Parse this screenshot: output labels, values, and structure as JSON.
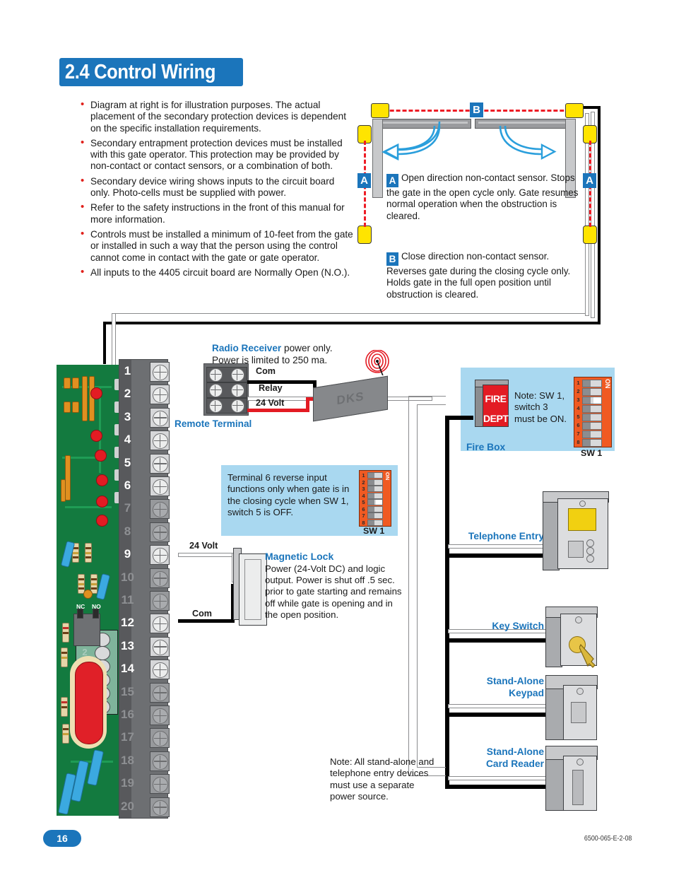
{
  "header": {
    "section_number": "2.4",
    "title": "2.4 Control Wiring"
  },
  "bullets": [
    "Diagram at right is for illustration purposes. The actual placement of the secondary protection devices is dependent on the specific installation requirements.",
    "Secondary entrapment protection devices must be installed with this gate operator. This protection may be provided by non-contact or contact sensors, or a combination of both.",
    "Secondary device wiring shows inputs to the circuit board only. Photo-cells must be supplied with power.",
    "Refer to the safety instructions in the front of this manual for more information.",
    "Controls must be installed a minimum of 10-feet from the gate or installed in such a way that the person using the control cannot come in contact with the gate or gate operator.",
    "All inputs to the 4405 circuit board are Normally Open (N.O.)."
  ],
  "gate_diagram": {
    "badge_a": "A",
    "badge_b": "B",
    "sensor_a_text": "Open direction non-contact sensor. Stops the gate in the open cycle only. Gate resumes normal operation when the obstruction is cleared.",
    "sensor_b_text": "Close direction non-contact sensor. Reverses gate during the closing cycle only. Holds gate in the full open position until obstruction is cleared."
  },
  "radio_receiver": {
    "title_bold": "Radio Receiver",
    "title_rest": " power only.",
    "line2": "Power is limited to 250 ma.",
    "terminal_label": "Remote Terminal",
    "wire_com": "Com",
    "wire_relay": "Relay",
    "wire_24volt": "24 Volt",
    "device_brand": "DKS"
  },
  "fire_box": {
    "label": "Fire Box",
    "face_line1": "FIRE",
    "face_line2": "DEPT",
    "note": "Note: SW 1, switch 3 must be ON.",
    "dip_label": "SW 1",
    "dip_on_label": "ON",
    "dip_positions": [
      "1",
      "2",
      "3",
      "4",
      "5",
      "6",
      "7",
      "8"
    ],
    "dip_active": 3
  },
  "terminal6_note": {
    "text": "Terminal 6 reverse input functions only when gate is in the closing cycle when SW 1, switch 5 is OFF.",
    "dip_label": "SW 1",
    "dip_on_label": "ON",
    "dip_positions": [
      "1",
      "2",
      "3",
      "4",
      "5",
      "6",
      "7",
      "8"
    ],
    "dip_active": 5
  },
  "magnetic_lock": {
    "title": "Magnetic Lock",
    "text": "Power (24-Volt DC) and logic output. Power is shut off .5 sec. prior to gate starting and remains off while gate is opening and in the open position.",
    "wire_24volt": "24 Volt",
    "wire_com": "Com"
  },
  "terminal_strip": {
    "terminals": [
      {
        "n": "1",
        "active": true
      },
      {
        "n": "2",
        "active": true
      },
      {
        "n": "3",
        "active": true
      },
      {
        "n": "4",
        "active": true
      },
      {
        "n": "5",
        "active": true
      },
      {
        "n": "6",
        "active": true
      },
      {
        "n": "7",
        "active": false
      },
      {
        "n": "8",
        "active": false
      },
      {
        "n": "9",
        "active": true
      },
      {
        "n": "10",
        "active": false
      },
      {
        "n": "11",
        "active": false
      },
      {
        "n": "12",
        "active": true
      },
      {
        "n": "13",
        "active": true
      },
      {
        "n": "14",
        "active": true
      },
      {
        "n": "15",
        "active": false
      },
      {
        "n": "16",
        "active": false
      },
      {
        "n": "17",
        "active": false
      },
      {
        "n": "18",
        "active": false
      },
      {
        "n": "19",
        "active": false
      },
      {
        "n": "20",
        "active": false
      }
    ]
  },
  "circuit_board": {
    "secondary_terminals": [
      {
        "n": "1",
        "active": true
      },
      {
        "n": "2",
        "active": false
      },
      {
        "n": "3",
        "active": false
      },
      {
        "n": "4",
        "active": false
      },
      {
        "n": "5",
        "active": true
      },
      {
        "n": "6",
        "active": false
      }
    ],
    "relay_nc": "NC",
    "relay_no": "NO"
  },
  "devices": [
    {
      "name": "Telephone Entry",
      "label": "Telephone Entry"
    },
    {
      "name": "Key Switch",
      "label": "Key Switch"
    },
    {
      "name": "Stand-Alone Keypad",
      "label": "Stand-Alone\nKeypad"
    },
    {
      "name": "Stand-Alone Card Reader",
      "label": "Stand-Alone\nCard Reader"
    }
  ],
  "device_labels": {
    "telephone_entry": "Telephone Entry",
    "key_switch": "Key Switch",
    "keypad_l1": "Stand-Alone",
    "keypad_l2": "Keypad",
    "card_reader_l1": "Stand-Alone",
    "card_reader_l2": "Card Reader"
  },
  "bottom_note": "Note: All stand-alone and telephone entry devices must use a separate power source.",
  "footer": {
    "page_number": "16",
    "document_code": "6500-065-E-2-08"
  },
  "colors": {
    "brand_blue": "#1b75bb",
    "red": "#e0201b",
    "beam_red": "#ee1c25",
    "sensor_yellow": "#ffe400",
    "note_blue": "#a9d8f0",
    "dip_orange": "#f05a22",
    "pcb_green": "#137a3f"
  }
}
